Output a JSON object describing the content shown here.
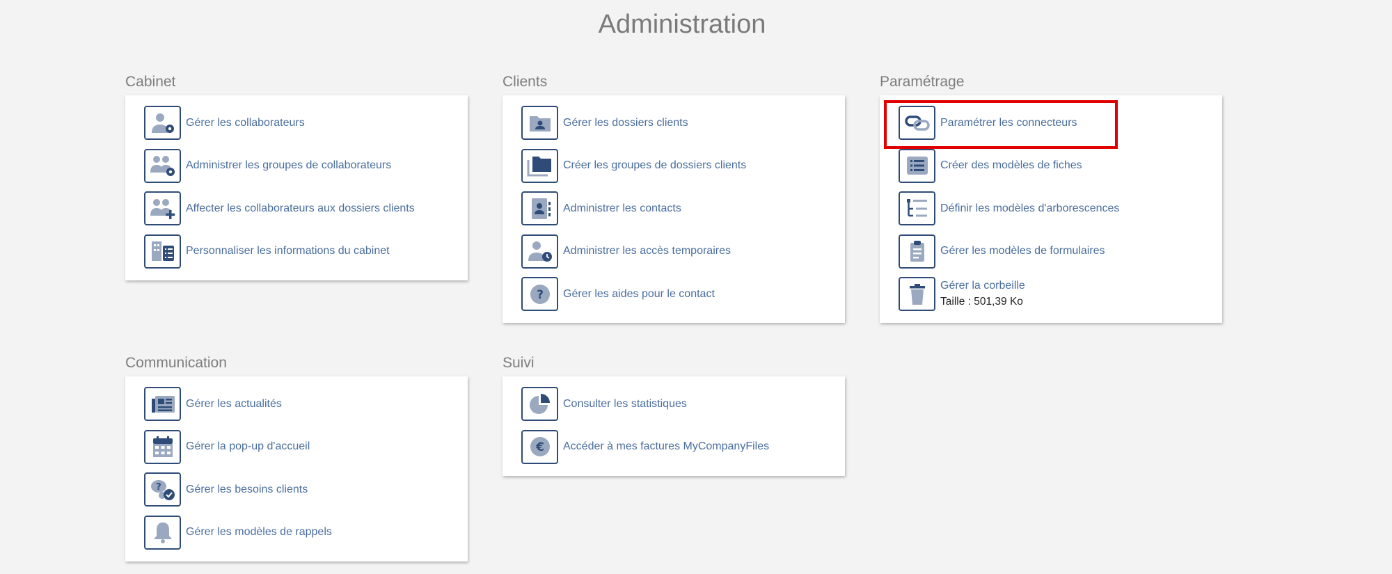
{
  "page": {
    "title": "Administration"
  },
  "colors": {
    "accent": "#2f4c78",
    "link": "#4a6e9e",
    "icon_fill": "#9aa8c0",
    "highlight": "#e00000"
  },
  "sections": {
    "cabinet": {
      "title": "Cabinet",
      "items": [
        {
          "label": "Gérer les collaborateurs",
          "icon": "user-gear-icon"
        },
        {
          "label": "Administrer les groupes de collaborateurs",
          "icon": "users-gear-icon"
        },
        {
          "label": "Affecter les collaborateurs aux dossiers clients",
          "icon": "users-plus-icon"
        },
        {
          "label": "Personnaliser les informations du cabinet",
          "icon": "building-list-icon"
        }
      ]
    },
    "clients": {
      "title": "Clients",
      "items": [
        {
          "label": "Gérer les dossiers clients",
          "icon": "folder-user-icon"
        },
        {
          "label": "Créer les groupes de dossiers clients",
          "icon": "folders-icon"
        },
        {
          "label": "Administrer les contacts",
          "icon": "contact-book-icon"
        },
        {
          "label": "Administrer les accès temporaires",
          "icon": "user-clock-icon"
        },
        {
          "label": "Gérer les aides pour le contact",
          "icon": "question-icon"
        }
      ]
    },
    "parametrage": {
      "title": "Paramétrage",
      "items": [
        {
          "label": "Paramétrer les connecteurs",
          "icon": "link-icon"
        },
        {
          "label": "Créer des modèles de fiches",
          "icon": "list-icon"
        },
        {
          "label": "Définir les modèles d'arborescences",
          "icon": "tree-icon"
        },
        {
          "label": "Gérer les modèles de formulaires",
          "icon": "clipboard-icon"
        },
        {
          "label": "Gérer la corbeille",
          "sub": "Taille : 501,39 Ko",
          "icon": "trash-icon"
        }
      ]
    },
    "communication": {
      "title": "Communication",
      "items": [
        {
          "label": "Gérer les actualités",
          "icon": "newspaper-icon"
        },
        {
          "label": "Gérer la pop-up d'accueil",
          "icon": "calendar-icon"
        },
        {
          "label": "Gérer les besoins clients",
          "icon": "chat-check-icon"
        },
        {
          "label": "Gérer les modèles de rappels",
          "icon": "bell-icon"
        }
      ]
    },
    "suivi": {
      "title": "Suivi",
      "items": [
        {
          "label": "Consulter les statistiques",
          "icon": "pie-chart-icon"
        },
        {
          "label": "Accéder à mes factures MyCompanyFiles",
          "icon": "euro-icon"
        }
      ]
    }
  }
}
